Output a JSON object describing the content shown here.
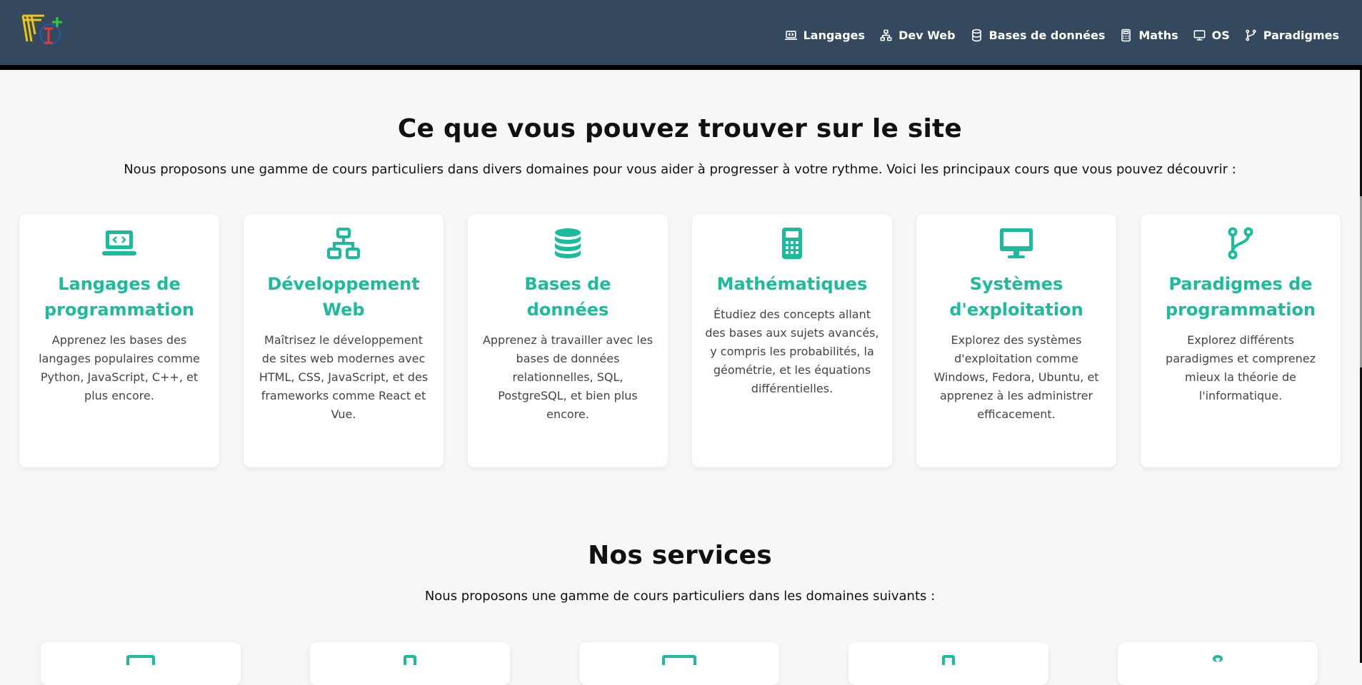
{
  "navbar": {
    "logo_text": "FI+",
    "colors": {
      "background": "#34495e",
      "accent": "#1abc9c"
    },
    "items": [
      {
        "label": "Langages",
        "icon": "laptop-code-icon"
      },
      {
        "label": "Dev Web",
        "icon": "sitemap-icon"
      },
      {
        "label": "Bases de données",
        "icon": "database-icon"
      },
      {
        "label": "Maths",
        "icon": "calculator-icon"
      },
      {
        "label": "OS",
        "icon": "desktop-icon"
      },
      {
        "label": "Paradigmes",
        "icon": "code-branch-icon"
      }
    ]
  },
  "intro": {
    "title": "Ce que vous pouvez trouver sur le site",
    "lead": "Nous proposons une gamme de cours particuliers dans divers domaines pour vous aider à progresser à votre rythme. Voici les principaux cours que vous pouvez découvrir :",
    "cards": [
      {
        "icon": "laptop-code-icon",
        "title": "Langages de programmation",
        "description": "Apprenez les bases des langages populaires comme Python, JavaScript, C++, et plus encore."
      },
      {
        "icon": "sitemap-icon",
        "title": "Développement Web",
        "description": "Maîtrisez le développement de sites web modernes avec HTML, CSS, JavaScript, et des frameworks comme React et Vue."
      },
      {
        "icon": "database-icon",
        "title": "Bases de données",
        "description": "Apprenez à travailler avec les bases de données relationnelles, SQL, PostgreSQL, et bien plus encore."
      },
      {
        "icon": "calculator-icon",
        "title": "Mathématiques",
        "description": "Étudiez des concepts allant des bases aux sujets avancés, y compris les probabilités, la géométrie, et les équations différentielles."
      },
      {
        "icon": "desktop-icon",
        "title": "Systèmes d'exploitation",
        "description": "Explorez des systèmes d'exploitation comme Windows, Fedora, Ubuntu, et apprenez à les administrer efficacement."
      },
      {
        "icon": "code-branch-icon",
        "title": "Paradigmes de programmation",
        "description": "Explorez différents paradigmes et comprenez mieux la théorie de l'informatique."
      }
    ]
  },
  "services": {
    "title": "Nos services",
    "lead": "Nous proposons une gamme de cours particuliers dans les domaines suivants :"
  }
}
